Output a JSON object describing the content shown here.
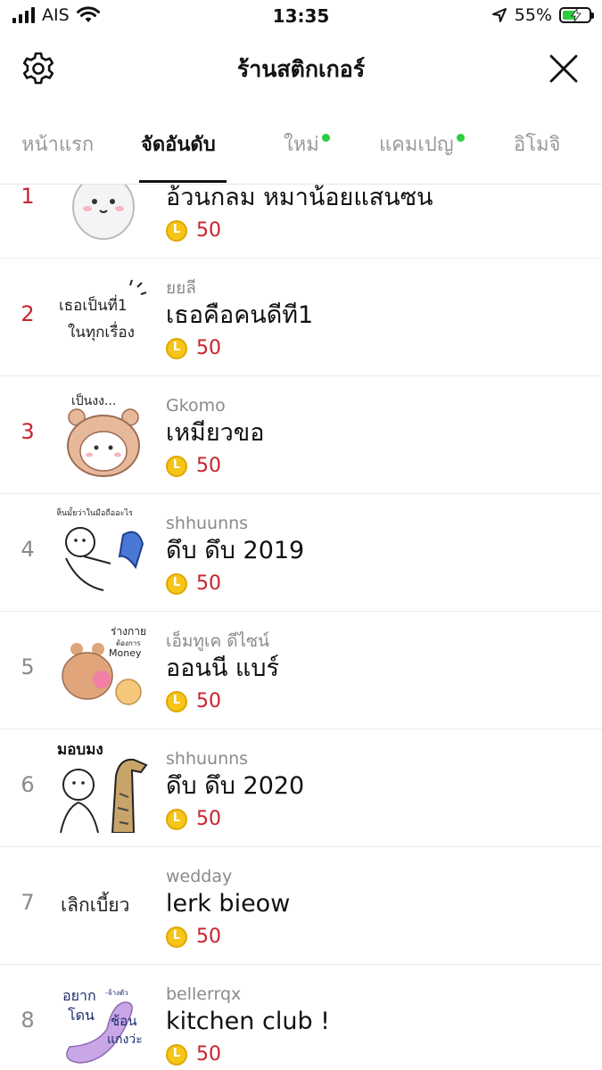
{
  "status_bar": {
    "carrier": "AIS",
    "time": "13:35",
    "battery": "55%",
    "battery_level": 0.55
  },
  "header": {
    "title": "ร้านสติกเกอร์",
    "left_icon": "gear-icon",
    "right_icon": "close-icon"
  },
  "tabs": [
    {
      "label": "หน้าแรก",
      "active": false,
      "new_dot": false
    },
    {
      "label": "จัดอันดับ",
      "active": true,
      "new_dot": false
    },
    {
      "label": "ใหม่",
      "active": false,
      "new_dot": true
    },
    {
      "label": "แคมเปญ",
      "active": false,
      "new_dot": true
    },
    {
      "label": "อิโมจิ",
      "active": false,
      "new_dot": false
    }
  ],
  "colors": {
    "accent_red": "#c8232c",
    "new_dot_green": "#2ecc40",
    "coin_gold": "#f5c518"
  },
  "ranking": [
    {
      "rank": "1",
      "author": "",
      "name": "อ้วนกลม หมาน้อยแสนซน",
      "price": "50"
    },
    {
      "rank": "2",
      "author": "ยยลี",
      "name": "เธอคือคนดีที1",
      "price": "50",
      "thumb_text": [
        "เธอเป็นที่1",
        "ในทุกเรื่อง"
      ]
    },
    {
      "rank": "3",
      "author": "Gkomo",
      "name": "เหมียวขอ",
      "price": "50",
      "thumb_text": [
        "เป็นงง..."
      ]
    },
    {
      "rank": "4",
      "author": "shhuunns",
      "name": "ดึบ ดึบ 2019",
      "price": "50",
      "thumb_text": [
        "เห็นมั้ยว่าในมือถืออะไร"
      ]
    },
    {
      "rank": "5",
      "author": "เอ็มทูเค ดีไซน์",
      "name": "ออนนี แบร์",
      "price": "50",
      "thumb_text": [
        "ร่างกาย",
        "ต้องการ",
        "Money"
      ]
    },
    {
      "rank": "6",
      "author": "shhuunns",
      "name": "ดึบ ดึบ 2020",
      "price": "50",
      "thumb_text": [
        "มอบมง"
      ]
    },
    {
      "rank": "7",
      "author": "wedday",
      "name": "lerk bieow",
      "price": "50",
      "thumb_text": [
        "เลิกเบี้ยว"
      ]
    },
    {
      "rank": "8",
      "author": "bellerrqx",
      "name": "kitchen club !",
      "price": "50",
      "thumb_text": [
        "อยาก",
        "โดน",
        "ช้อน",
        "แกงว่ะ",
        "-จ้างตัว"
      ]
    }
  ]
}
